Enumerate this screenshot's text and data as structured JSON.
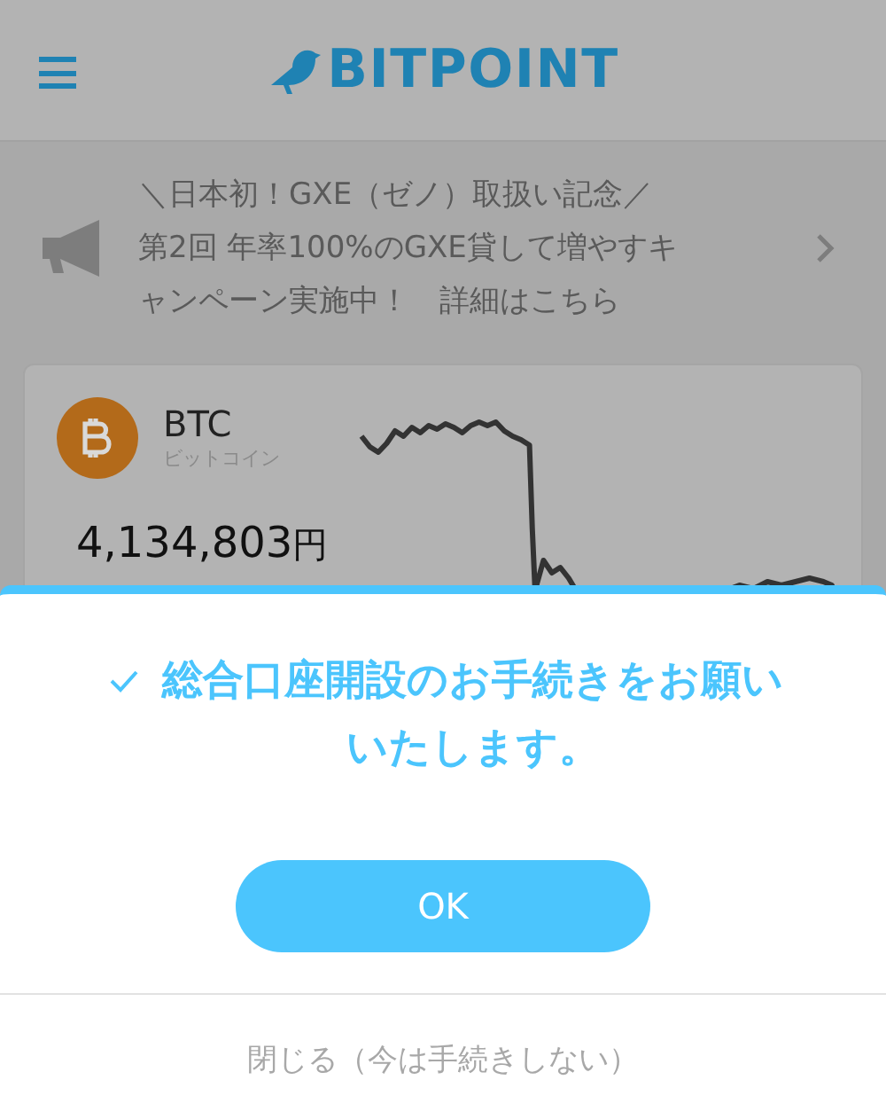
{
  "header": {
    "logo": "BITPOINT"
  },
  "announcement": {
    "lines": [
      "＼日本初！GXE（ゼノ）取扱い記念／",
      "第2回 年率100%のGXE貸して増やすキ",
      "ャンペーン実施中！　詳細はこちら"
    ]
  },
  "coin": {
    "symbol": "BTC",
    "name": "ビットコイン",
    "price": "4,134,803",
    "unit": "円"
  },
  "dialog": {
    "title_lines": [
      "総合口座開設のお手続きをお願い",
      "いたします。"
    ],
    "ok": "OK",
    "close": "閉じる（今は手続きしない）"
  }
}
